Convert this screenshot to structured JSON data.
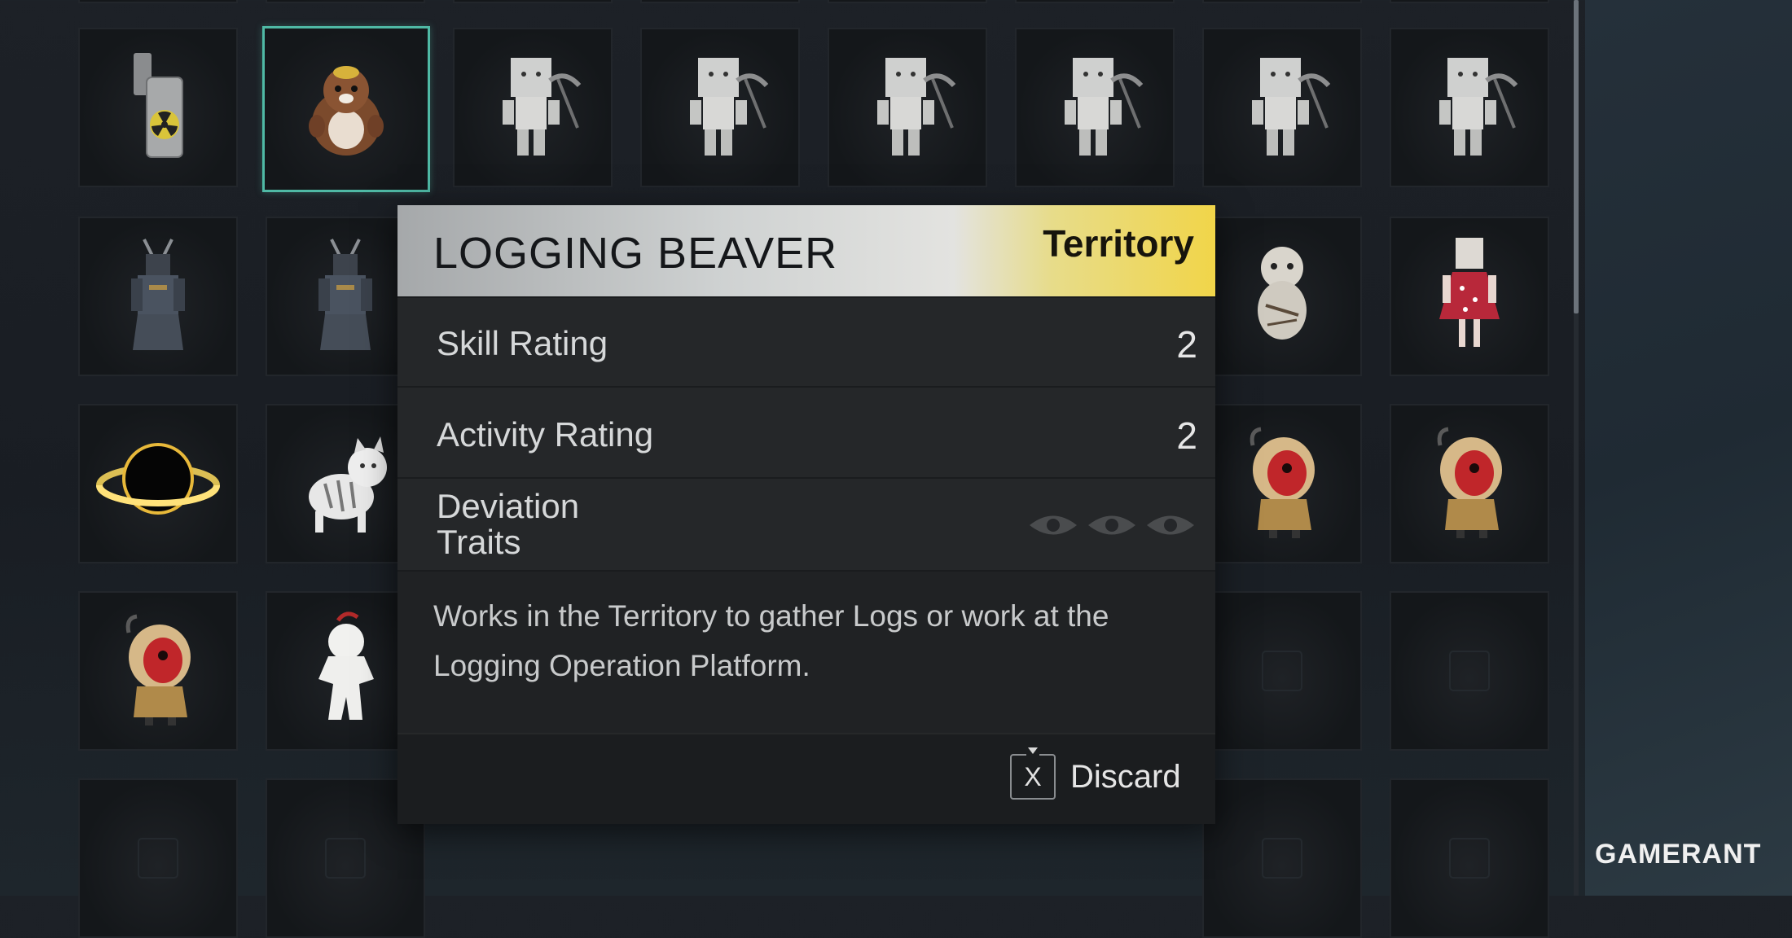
{
  "inventory": {
    "rows": [
      [
        "lighter-icon",
        "beaver-plush-icon",
        "pickaxe-robot-icon",
        "pickaxe-robot-icon",
        "pickaxe-robot-icon",
        "pickaxe-robot-icon",
        "pickaxe-robot-icon",
        "pickaxe-robot-icon"
      ],
      [
        "samurai-armor-icon",
        "samurai-armor-icon",
        "",
        "",
        "",
        "",
        "voodoo-doll-icon",
        "paper-bag-girl-icon"
      ],
      [
        "black-hole-ring-icon",
        "striped-cat-icon",
        "",
        "",
        "",
        "",
        "red-mask-hooded-figure-icon",
        "red-mask-hooded-figure-icon"
      ],
      [
        "red-mask-hooded-figure-icon",
        "white-paper-doll-icon",
        "",
        "",
        "",
        "",
        "empty-slot",
        "empty-slot"
      ],
      [
        "empty-slot",
        "empty-slot",
        "",
        "",
        "",
        "",
        "empty-slot",
        "empty-slot"
      ]
    ],
    "selected": "beaver-plush-icon",
    "selection_color": "#4fb9a5"
  },
  "tooltip": {
    "name": "LOGGING BEAVER",
    "tag": "Territory",
    "tag_color": "#f1d549",
    "stats": [
      {
        "label": "Skill Rating",
        "value": "2"
      },
      {
        "label": "Activity Rating",
        "value": "2"
      }
    ],
    "traits_label_line1": "Deviation",
    "traits_label_line2": "Traits",
    "traits_icons": [
      "eye-icon",
      "eye-icon",
      "eye-icon"
    ],
    "description": "Works in the Territory to gather Logs or work at the Logging Operation Platform.",
    "action_key": "X",
    "action_label": "Discard"
  },
  "watermark": {
    "part1": "GAME",
    "part2": "RANT"
  }
}
